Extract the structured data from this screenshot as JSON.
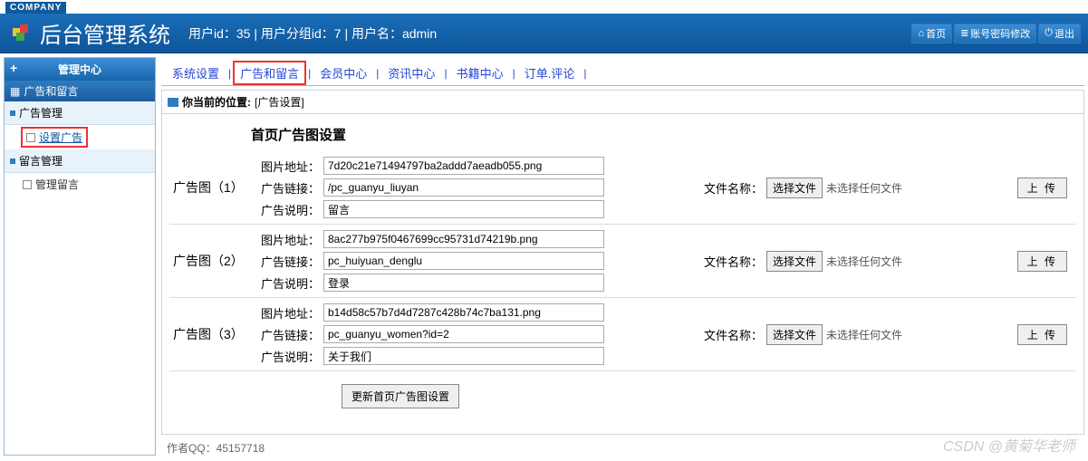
{
  "company_tag": "COMPANY",
  "system_title": "后台管理系统",
  "user_info": "用户id：35 | 用户分组id：7 | 用户名：admin",
  "header_buttons": {
    "home": "首页",
    "pwd": "账号密码修改",
    "exit": "退出"
  },
  "sidebar": {
    "title": "管理中心",
    "section": "广告和留言",
    "cat1": "广告管理",
    "item1": "设置广告",
    "cat2": "留言管理",
    "item2": "管理留言"
  },
  "tabs": {
    "t1": "系统设置",
    "t2": "广告和留言",
    "t3": "会员中心",
    "t4": "资讯中心",
    "t5": "书籍中心",
    "t6": "订单.评论"
  },
  "crumb": {
    "label": "你当前的位置:",
    "loc": "[广告设置]"
  },
  "page_heading": "首页广告图设置",
  "field_labels": {
    "img": "图片地址：",
    "link": "广告链接：",
    "desc": "广告说明：",
    "file_name": "文件名称：",
    "choose": "选择文件",
    "no_file": "未选择任何文件",
    "upload": "上 传"
  },
  "ads": [
    {
      "title": "广告图（1）",
      "img": "7d20c21e71494797ba2addd7aeadb055.png",
      "link": "/pc_guanyu_liuyan",
      "desc": "留言"
    },
    {
      "title": "广告图（2）",
      "img": "8ac277b975f0467699cc95731d74219b.png",
      "link": "pc_huiyuan_denglu",
      "desc": "登录"
    },
    {
      "title": "广告图（3）",
      "img": "b14d58c57b7d4d7287c428b74c7ba131.png",
      "link": "pc_guanyu_women?id=2",
      "desc": "关于我们"
    }
  ],
  "submit_label": "更新首页广告图设置",
  "footer": "作者QQ：45157718",
  "watermark": "CSDN @黄菊华老师"
}
